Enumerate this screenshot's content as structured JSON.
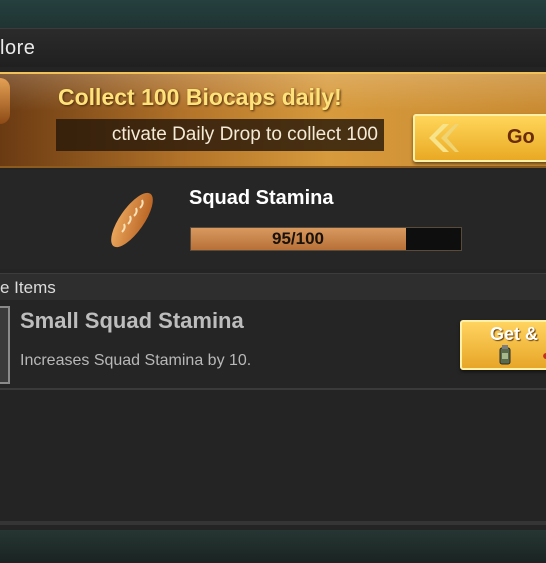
{
  "panel": {
    "title": "lore"
  },
  "banner": {
    "title": "Collect 100 Biocaps daily!",
    "subtitle": "ctivate Daily Drop to collect 100",
    "go_label": "Go"
  },
  "stamina": {
    "title": "Squad Stamina",
    "value_text": "95/100",
    "value": 95,
    "max": 100
  },
  "items_section": {
    "header": "e Items",
    "items": [
      {
        "name": "Small Squad Stamina",
        "description": "Increases Squad Stamina by 10.",
        "button_label": "Get &"
      }
    ]
  },
  "icons": {
    "banner": "bread-icon",
    "stamina": "bread-icon",
    "go_button": "chevron-left-icon",
    "item": "bread-icon",
    "currency": "canister-icon"
  },
  "colors": {
    "banner_title": "#ffe27a",
    "button_gold": "#e9a924",
    "bar_fill": "#c78148"
  }
}
